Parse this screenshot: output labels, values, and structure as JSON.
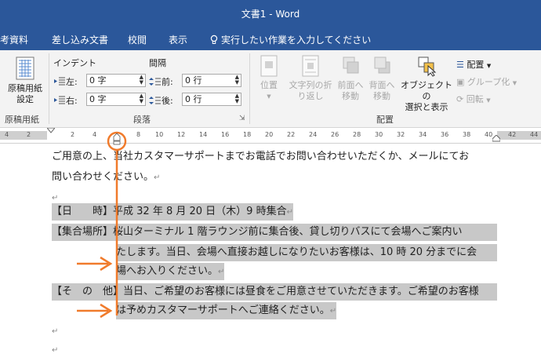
{
  "window": {
    "title": "文書1 - Word"
  },
  "tabs": [
    "考資料",
    "差し込み文書",
    "校閲",
    "表示"
  ],
  "tell_me": "実行したい作業を入力してください",
  "ribbon": {
    "genko": {
      "button_line1": "原稿用紙",
      "button_line2": "設定",
      "group": "原稿用紙"
    },
    "paragraph": {
      "indent_label": "インデント",
      "left_label": "左:",
      "left_value": "0 字",
      "right_label": "右:",
      "right_value": "0 字",
      "spacing_label": "間隔",
      "before_label": "前:",
      "before_value": "0 行",
      "after_label": "後:",
      "after_value": "0 行",
      "group": "段落"
    },
    "arrange": {
      "position": "位置",
      "wrap_line1": "文字列の折",
      "wrap_line2": "り返し",
      "forward_line1": "前面へ",
      "forward_line2": "移動",
      "backward_line1": "背面へ",
      "backward_line2": "移動",
      "select_line1": "オブジェクトの",
      "select_line2": "選択と表示",
      "align": "配置",
      "group_btn": "グループ化",
      "rotate": "回転",
      "group": "配置"
    }
  },
  "ruler": {
    "left_nums": [
      "4",
      "2"
    ],
    "nums": [
      "2",
      "4",
      "6",
      "8",
      "10",
      "12",
      "14",
      "16",
      "18",
      "20",
      "22",
      "24",
      "26",
      "28",
      "30",
      "32",
      "34",
      "36",
      "38",
      "40"
    ],
    "right_nums": [
      "42",
      "44"
    ]
  },
  "document": {
    "p1_line1": "ご用意の上、当社カスタマーサポートまでお電話でお問い合わせいただくか、メールにてお",
    "p1_line2": "問い合わせください。",
    "date_label": "【日　　時】",
    "date_text": "平成 32 年 8 月 20 日（木）9 時集合",
    "place_label": "【集合場所】",
    "place_line1": "桜山ターミナル 1 階ラウンジ前に集合後、貸し切りバスにて会場へご案内い",
    "place_line2": "たします。当日、会場へ直接お越しになりたいお客様は、10 時 20 分までに会",
    "place_line3": "場へお入りください。",
    "other_label": "【そ　の　他】",
    "other_line1": "当日、ご希望のお客様には昼食をご用意させていただきます。ご希望のお客様",
    "other_line2": "は予めカスタマーサポートへご連絡ください。",
    "para_mark": "↵"
  },
  "colors": {
    "word_blue": "#2b579a",
    "highlight": "#c8c8c8",
    "callout": "#f07b2c"
  }
}
